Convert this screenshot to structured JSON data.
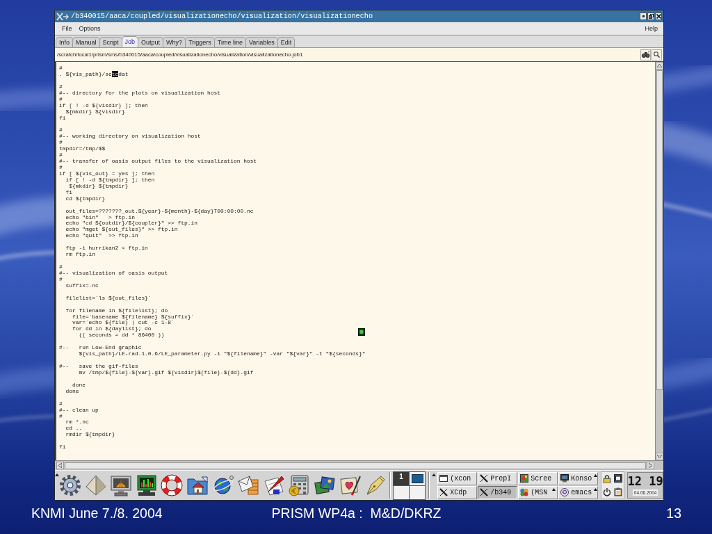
{
  "window": {
    "title": "/b340015/aaca/coupled/visualizationecho/visualization/visualizationecho"
  },
  "menu_bar": {
    "left_items": [
      "File",
      "Options"
    ],
    "right_items": [
      "Help"
    ]
  },
  "tabs": [
    {
      "label": "Info",
      "selected": false
    },
    {
      "label": "Manual",
      "selected": false
    },
    {
      "label": "Script",
      "selected": false
    },
    {
      "label": "Job",
      "selected": true
    },
    {
      "label": "Output",
      "selected": false
    },
    {
      "label": "Why?",
      "selected": false
    },
    {
      "label": "Triggers",
      "selected": false
    },
    {
      "label": "Time line",
      "selected": false
    },
    {
      "label": "Variables",
      "selected": false
    },
    {
      "label": "Edit",
      "selected": false
    }
  ],
  "path_bar": {
    "path": "/scratch/local1/prism/sms/b340015/aaca/coupled/visualizationecho/visualization/visualizationecho.job1"
  },
  "script_view": {
    "blocks": [
      [
        "#",
        {
          "segments": [
            {
              "text": ". ${vis_path}/se",
              "highlighted": false
            },
            {
              "text": "tc",
              "highlighted": true
            },
            {
              "text": "dat",
              "highlighted": false
            }
          ]
        }
      ],
      [
        "#",
        "#-- directory for the plots on visualization host",
        "#",
        "if [ ! -d ${visdir} ]; then",
        "  ${mkdir} ${visdir}",
        "fi"
      ],
      [
        "#",
        "#-- working directory on visualization host",
        "#",
        "tmpdir=/tmp/$$",
        "#",
        "#-- transfer of oasis output files to the visualization host",
        "#",
        "if [ ${vis_out} = yes ]; then",
        "  if [ ! -d ${tmpdir} ]; then",
        "   ${mkdir} ${tmpdir}",
        "  fi",
        "  cd ${tmpdir}"
      ],
      [
        "  out_files=???????_out.${year}-${month}-${day}T00:00:00.nc",
        "  echo \"bin\"   > ftp.in",
        "  echo \"cd ${outdir}/${coupler}\" >> ftp.in",
        "  echo \"mget ${out_files}\" >> ftp.in",
        "  echo \"quit\"  >> ftp.in"
      ],
      [
        "  ftp -i hurrikan2 < ftp.in",
        "  rm ftp.in"
      ],
      [
        "#",
        "#-- visualization of oasis output",
        "#",
        "  suffix=.nc"
      ],
      [
        "  filelist=`ls ${out_files}`"
      ],
      [
        "  for filename in ${filelist}; do",
        "    file=`basename ${filename} ${suffix}`",
        "    var=`echo ${file} | cut -c 1-8`",
        "    for dd in ${daylist}; do",
        "      (( seconds = dd * 86400 ))"
      ],
      [
        "#--   run Low-End graphic",
        "      ${vis_path}/LE-rad.1.0.6/LE_parameter.py -i \"${filename}\" -var \"${var}\" -t \"${seconds}\""
      ],
      [
        "#--   save the gif-files",
        "      mv /tmp/${file}-${var}.gif ${visdir}${file}-${dd}.gif"
      ],
      [
        "    done",
        "  done"
      ],
      [
        "#",
        "#-- clean up",
        "#",
        "  rm *.nc",
        "  cd ..",
        "  rmdir ${tmpdir}"
      ],
      [
        "fi"
      ]
    ]
  },
  "taskbar": {
    "pager": {
      "desktops": [
        {
          "label": "1",
          "selected": true,
          "window_preview": false
        },
        {
          "selected": false,
          "window_preview": true
        },
        {
          "selected": false,
          "window_preview": false
        },
        {
          "selected": false,
          "window_preview": false
        }
      ]
    },
    "tasks": [
      {
        "label": "(xcon",
        "selected": false,
        "grouped": false
      },
      {
        "label": "PrepI",
        "selected": false,
        "grouped": false
      },
      {
        "label": "Scree",
        "selected": false,
        "grouped": false
      },
      {
        "label": "Konso",
        "selected": false,
        "grouped": true
      },
      {
        "label": "XCdp",
        "selected": false,
        "grouped": false
      },
      {
        "label": "/b340",
        "selected": true,
        "grouped": false
      },
      {
        "label": "(MSN",
        "selected": false,
        "grouped": true
      },
      {
        "label": "emacs",
        "selected": false,
        "grouped": true
      }
    ],
    "clock": {
      "time": "12 19",
      "date": "04.06.2004"
    }
  },
  "footer": {
    "left": "KNMI June 7./8. 2004",
    "center": "PRISM WP4a :  M&D/DKRZ",
    "page_number": "13"
  }
}
